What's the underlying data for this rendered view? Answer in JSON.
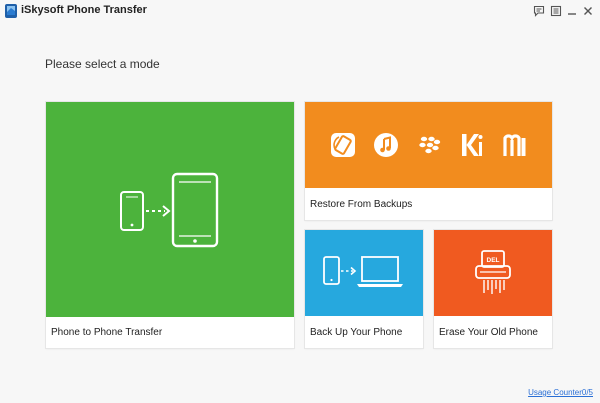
{
  "window": {
    "title": "iSkysoft Phone Transfer",
    "controls": [
      "feedback-icon",
      "menu-icon",
      "minimize-icon",
      "close-icon"
    ]
  },
  "main": {
    "prompt": "Please select a mode",
    "modes": [
      {
        "label": "Phone to Phone Transfer",
        "color": "#4cb33c"
      },
      {
        "label": "Restore From Backups",
        "color": "#f28c1e"
      },
      {
        "label": "Back Up Your Phone",
        "color": "#26a8de"
      },
      {
        "label": "Erase Your Old Phone",
        "color": "#f05a20"
      }
    ],
    "restore_icons": [
      "phone-backup-icon",
      "itunes-icon",
      "blackberry-icon",
      "kies-icon",
      "mobiletrans-icon"
    ]
  },
  "footer": {
    "usage_link": "Usage Counter0/5"
  }
}
